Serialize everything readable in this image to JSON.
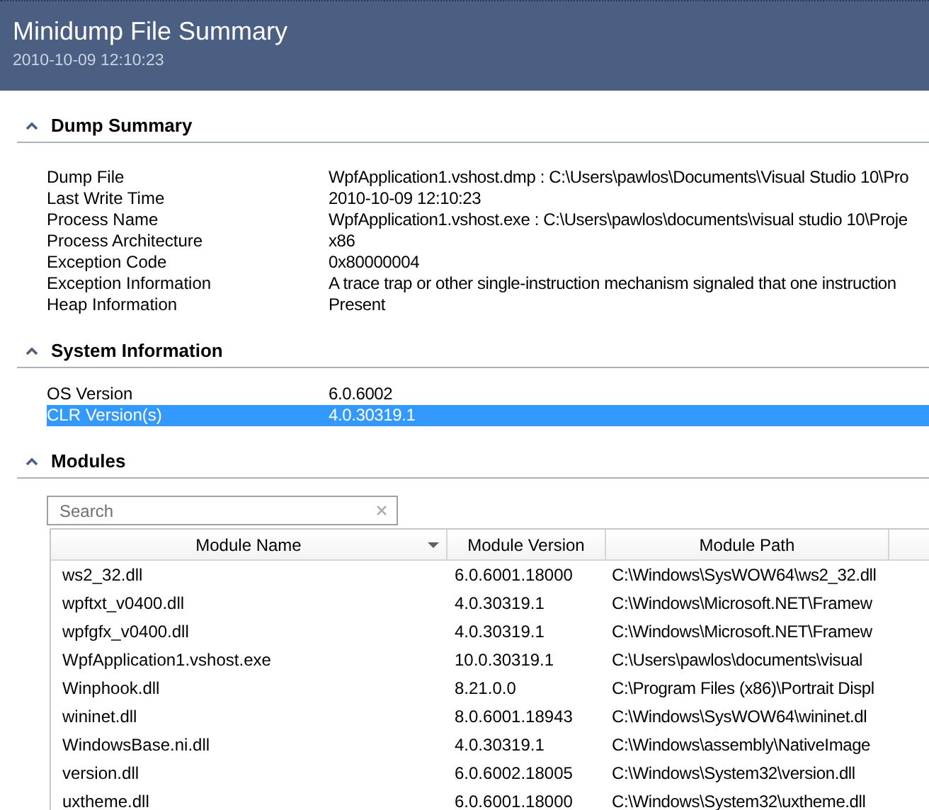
{
  "header": {
    "title": "Minidump File Summary",
    "timestamp": "2010-10-09 12:10:23"
  },
  "sections": [
    {
      "title": "Dump Summary",
      "expanded": true,
      "kind": "properties",
      "rows": [
        {
          "label": "Dump File",
          "value": "WpfApplication1.vshost.dmp : C:\\Users\\pawlos\\Documents\\Visual Studio 10\\Pro",
          "selected": false
        },
        {
          "label": "Last Write Time",
          "value": "2010-10-09 12:10:23",
          "selected": false
        },
        {
          "label": "Process Name",
          "value": "WpfApplication1.vshost.exe : C:\\Users\\pawlos\\documents\\visual studio 10\\Proje",
          "selected": false
        },
        {
          "label": "Process Architecture",
          "value": "x86",
          "selected": false
        },
        {
          "label": "Exception Code",
          "value": "0x80000004",
          "selected": false
        },
        {
          "label": "Exception Information",
          "value": "A trace trap or other single-instruction mechanism signaled that one instruction",
          "selected": false
        },
        {
          "label": "Heap Information",
          "value": "Present",
          "selected": false
        }
      ]
    },
    {
      "title": "System Information",
      "expanded": true,
      "kind": "properties",
      "rows": [
        {
          "label": "OS Version",
          "value": "6.0.6002",
          "selected": false
        },
        {
          "label": "CLR Version(s)",
          "value": "4.0.30319.1",
          "selected": true
        }
      ]
    },
    {
      "title": "Modules",
      "expanded": true,
      "kind": "table",
      "search": {
        "placeholder": "Search"
      },
      "columns": [
        "Module Name",
        "Module Version",
        "Module Path"
      ],
      "rows": [
        [
          "ws2_32.dll",
          "6.0.6001.18000",
          "C:\\Windows\\SysWOW64\\ws2_32.dll"
        ],
        [
          "wpftxt_v0400.dll",
          "4.0.30319.1",
          "C:\\Windows\\Microsoft.NET\\Framew"
        ],
        [
          "wpfgfx_v0400.dll",
          "4.0.30319.1",
          "C:\\Windows\\Microsoft.NET\\Framew"
        ],
        [
          "WpfApplication1.vshost.exe",
          "10.0.30319.1",
          "C:\\Users\\pawlos\\documents\\visual"
        ],
        [
          "Winphook.dll",
          "8.21.0.0",
          "C:\\Program Files (x86)\\Portrait Displ"
        ],
        [
          "wininet.dll",
          "8.0.6001.18943",
          "C:\\Windows\\SysWOW64\\wininet.dl"
        ],
        [
          "WindowsBase.ni.dll",
          "4.0.30319.1",
          "C:\\Windows\\assembly\\NativeImage"
        ],
        [
          "version.dll",
          "6.0.6002.18005",
          "C:\\Windows\\System32\\version.dll"
        ],
        [
          "uxtheme.dll",
          "6.0.6001.18000",
          "C:\\Windows\\System32\\uxtheme.dll"
        ]
      ]
    }
  ]
}
